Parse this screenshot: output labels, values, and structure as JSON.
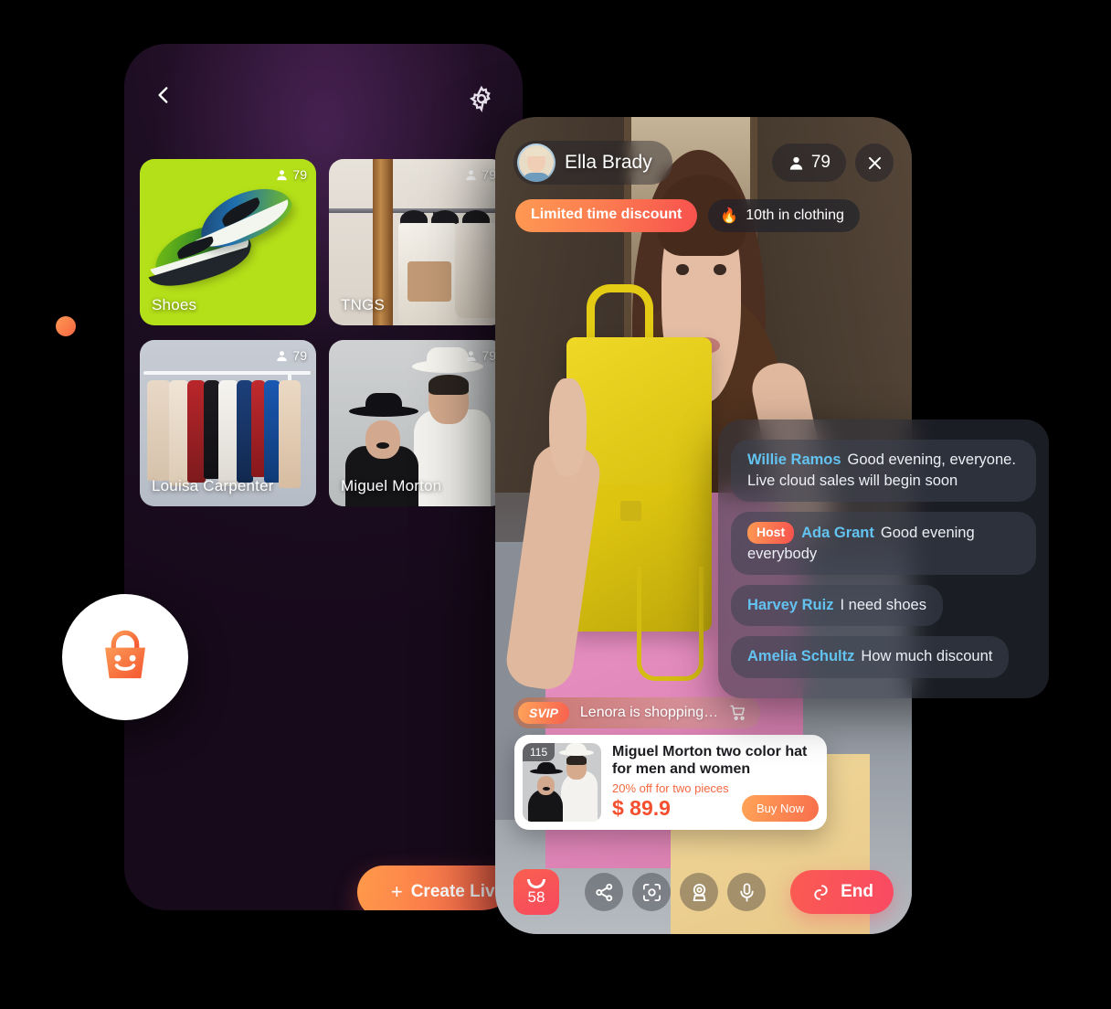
{
  "phone1": {
    "back_icon": "chevron-left-icon",
    "settings_icon": "gear-icon",
    "cards": [
      {
        "title": "Shoes",
        "viewers": "79",
        "viewer_icon": "person-icon"
      },
      {
        "title": "TNGS",
        "viewers": "79",
        "viewer_icon": "person-icon"
      },
      {
        "title": "Louisa Carpenter",
        "viewers": "79",
        "viewer_icon": "person-icon"
      },
      {
        "title": "Miguel Morton",
        "viewers": "79",
        "viewer_icon": "person-icon"
      }
    ],
    "logo_icon": "shopping-bag-smile-icon",
    "create_live": {
      "plus": "+",
      "label": "Create Live"
    }
  },
  "phone2": {
    "host": {
      "name": "Ella Brady",
      "avatar_icon": "host-avatar"
    },
    "viewers": {
      "count": "79",
      "icon": "person-icon"
    },
    "close_icon": "close-icon",
    "tags": [
      {
        "label": "Limited time discount",
        "style": "gradient"
      },
      {
        "label": "10th in clothing",
        "icon": "flame-icon",
        "style": "dark"
      }
    ],
    "chat": [
      {
        "name": "Willie Ramos",
        "text": "Good evening, everyone. Live cloud sales will begin soon",
        "badge": ""
      },
      {
        "name": "Ada Grant",
        "text": "Good evening everybody",
        "badge": "Host"
      },
      {
        "name": "Harvey Ruiz",
        "text": "I need shoes",
        "badge": ""
      },
      {
        "name": "Amelia Schultz",
        "text": "How much discount",
        "badge": ""
      }
    ],
    "svip": {
      "badge": "SVIP",
      "text": "Lenora is shopping…",
      "cart_icon": "shopping-cart-icon"
    },
    "product": {
      "qty": "115",
      "title": "Miguel Morton two color hat for men and women",
      "subtitle": "20% off for two pieces",
      "price": "$ 89.9",
      "buy_label": "Buy Now"
    },
    "bottom_bar": {
      "bag_count": "58",
      "bag_icon": "shopping-bag-icon",
      "icons": [
        "share-icon",
        "scan-icon",
        "camera-switch-icon",
        "microphone-icon"
      ],
      "end": {
        "label": "End",
        "icon": "link-broken-icon"
      }
    }
  },
  "colors": {
    "accent_start": "#ff9a52",
    "accent_end": "#f8514e",
    "end_button": "#f94a63",
    "chat_name": "#63c3f0",
    "phone1_bg": "#1d0e22",
    "card_green": "#b4e019"
  }
}
